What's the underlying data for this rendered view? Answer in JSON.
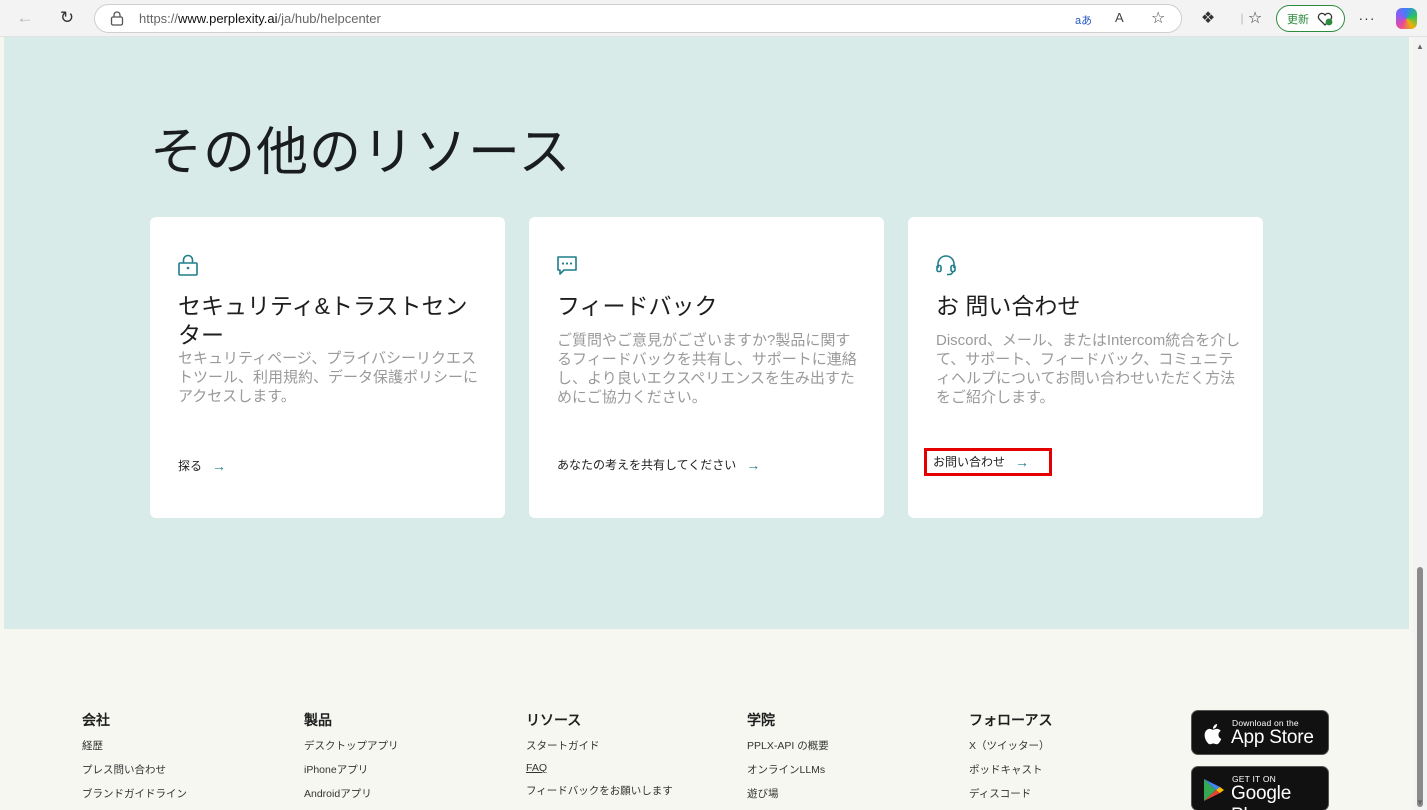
{
  "browser": {
    "url_prefix": "https://",
    "url_host": "www.perplexity.ai",
    "url_path": "/ja/hub/helpcenter",
    "translate_label": "aあ",
    "read_aloud_label": "A",
    "update_label": "更新"
  },
  "resources": {
    "title": "その他のリソース",
    "cards": [
      {
        "title": "セキュリティ&トラストセンター",
        "description": "セキュリティページ、プライバシーリクエストツール、利用規約、データ保護ポリシーにアクセスします。",
        "link": "探る",
        "icon": "lock-icon"
      },
      {
        "title": "フィードバック",
        "description": "ご質問やご意見がございますか?製品に関するフィードバックを共有し、サポートに連絡し、より良いエクスペリエンスを生み出すためにご協力ください。",
        "link": "あなたの考えを共有してください",
        "icon": "chat-icon"
      },
      {
        "title": "お 問い合わせ",
        "description": "Discord、メール、またはIntercom統合を介して、サポート、フィードバック、コミュニティヘルプについてお問い合わせいただく方法をご紹介します。",
        "link": "お問い合わせ",
        "icon": "headset-icon"
      }
    ]
  },
  "footer": {
    "columns": [
      {
        "title": "会社",
        "links": [
          "経歴",
          "プレス問い合わせ",
          "ブランドガイドライン"
        ]
      },
      {
        "title": "製品",
        "links": [
          "デスクトップアプリ",
          "iPhoneアプリ",
          "Androidアプリ"
        ]
      },
      {
        "title": "リソース",
        "links": [
          "スタートガイド",
          "FAQ",
          "フィードバックをお願いします"
        ]
      },
      {
        "title": "学院",
        "links": [
          "PPLX-API の概要",
          "オンラインLLMs",
          "遊び場"
        ]
      },
      {
        "title": "フォローアス",
        "links": [
          "X（ツイッター）",
          "ポッドキャスト",
          "ディスコード"
        ]
      }
    ],
    "app_store": {
      "sub": "Download on the",
      "name": "App Store"
    },
    "google_play": {
      "sub": "GET IT ON",
      "name": "Google Play"
    }
  },
  "colors": {
    "hero_bg": "#d8ebe8",
    "accent": "#1f7f8a",
    "highlight": "#e40000"
  }
}
